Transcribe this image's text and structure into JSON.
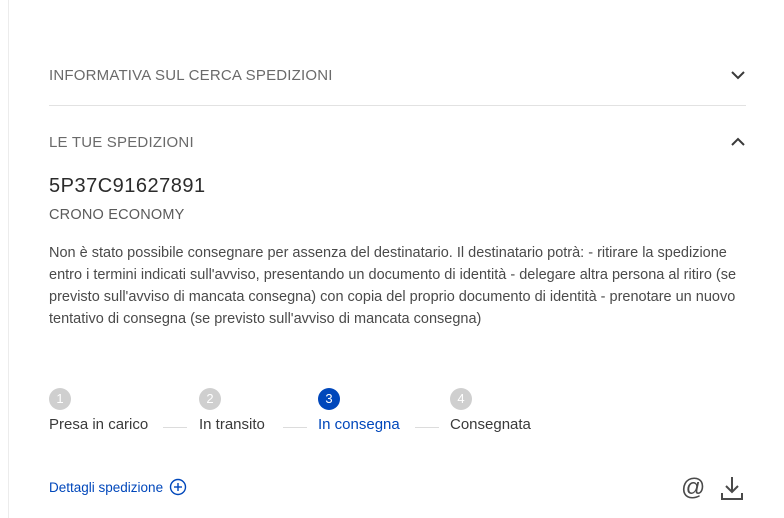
{
  "accordion_info": {
    "title": "INFORMATIVA SUL CERCA SPEDIZIONI",
    "icon": "chevron-down-icon"
  },
  "accordion_shipments": {
    "title": "LE TUE SPEDIZIONI",
    "icon": "chevron-up-icon"
  },
  "shipment": {
    "tracking_code": "5P37C91627891",
    "service": "CRONO ECONOMY",
    "message": "Non è stato possibile consegnare per assenza del destinatario. Il destinatario potrà: - ritirare la spedizione entro i termini indicati sull'avviso, presentando un documento di identità - delegare altra persona al ritiro (se previsto sull'avviso di mancata consegna) con copia del proprio documento di identità - prenotare un nuovo tentativo di consegna (se previsto sull'avviso di mancata consegna)"
  },
  "steps": [
    {
      "number": "1",
      "label": "Presa in carico",
      "active": false
    },
    {
      "number": "2",
      "label": "In transito",
      "active": false
    },
    {
      "number": "3",
      "label": "In consegna",
      "active": true
    },
    {
      "number": "4",
      "label": "Consegnata",
      "active": false
    }
  ],
  "details_link": {
    "label": "Dettagli spedizione",
    "icon": "plus-circle-icon"
  },
  "actions": {
    "email_icon": "at-icon",
    "download_icon": "download-icon"
  },
  "colors": {
    "accent": "#0047bb",
    "inactive_step": "#cfcfcf",
    "divider": "#e2e2e2"
  }
}
